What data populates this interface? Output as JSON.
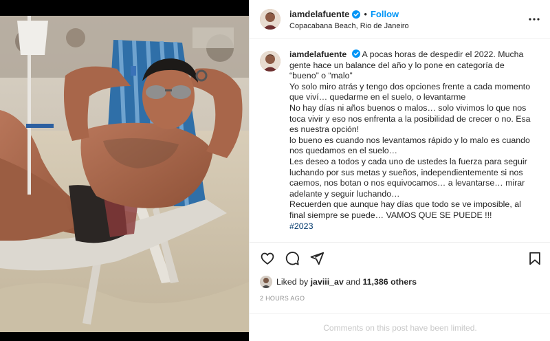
{
  "header": {
    "username": "iamdelafuente",
    "follow_label": "Follow",
    "location": "Copacabana Beach, Rio de Janeiro"
  },
  "caption": {
    "username": "iamdelafuente",
    "lines": [
      "A pocas horas de despedir el 2022. Mucha gente hace un balance del año y lo pone en categoría de “bueno” o “malo”",
      "Yo solo miro atrás y tengo dos opciones frente a cada momento que viví… quedarme en el suelo, o levantarme",
      "No hay días ni años buenos o malos… solo vivimos lo que nos toca vivir y eso nos enfrenta a la posibilidad de crecer o no. Esa es nuestra opción!",
      "lo bueno es cuando nos levantamos rápido y lo malo es cuando nos quedamos en el suelo…",
      "Les deseo a todos y cada uno de ustedes la fuerza para seguir luchando por sus metas y sueños, independientemente si nos caemos, nos botan o nos equivocamos… a levantarse… mirar adelante y seguir luchando…",
      "Recuerden que aunque hay días que todo se ve imposible, al final siempre se puede… VAMOS QUE SE PUEDE !!!"
    ],
    "hashtag": "#2023"
  },
  "likes": {
    "prefix": "Liked by",
    "user": "javiii_av",
    "and": "and",
    "count": "11,386 others"
  },
  "time": "2 HOURS AGO",
  "comments_limited": "Comments on this post have been limited.",
  "icons": {
    "like": "heart-icon",
    "comment": "comment-icon",
    "share": "share-icon",
    "save": "bookmark-icon",
    "more": "more-options-icon",
    "verified": "verified-badge-icon"
  },
  "colors": {
    "follow": "#0095f6",
    "verified": "#0095f6",
    "hashtag": "#00376b",
    "muted": "#8e8e8e"
  }
}
